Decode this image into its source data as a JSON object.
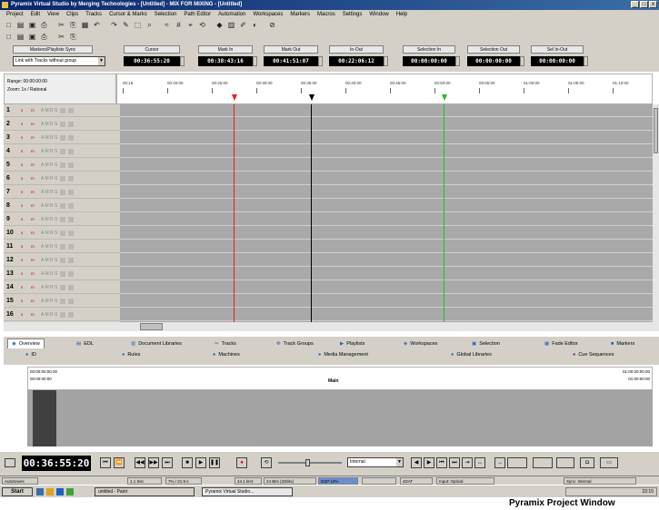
{
  "window": {
    "title": "Pyramix Virtual Studio by Merging Technologies - [Untitled] - MIX FOR MIXING - [Untitled]",
    "controls": [
      "_",
      "□",
      "x"
    ]
  },
  "menubar": [
    "Project",
    "Edit",
    "View",
    "Clips",
    "Tracks",
    "Cursor & Marks",
    "Selection",
    "Path Editor",
    "Automation",
    "Workspaces",
    "Markers",
    "Macros",
    "Settings",
    "Window",
    "Help"
  ],
  "toolbar1_icons": [
    "new-icon",
    "open-icon",
    "save-icon",
    "print-icon",
    "cut-icon",
    "copy-icon",
    "paste-icon",
    "undo-icon",
    "redo-icon",
    "tool-icon",
    "select-icon",
    "zoom-icon",
    "scrub-icon",
    "grid-icon",
    "snap-icon",
    "loop-icon",
    "marker-icon",
    "mix-icon",
    "edit-icon",
    "gain-icon",
    "mute-icon"
  ],
  "toolbar2_icons": [
    "view-icon",
    "track-icon",
    "layer-icon",
    "group-icon",
    "link-icon",
    "help-icon"
  ],
  "fields": {
    "markers": {
      "label": "Markers/Playlists Sync",
      "value": "Link with Tracks without group"
    },
    "cursor": {
      "label": "Cursor",
      "value": "00:36:55:20"
    },
    "mark_in": {
      "label": "Mark In",
      "value": "00:38:43:16"
    },
    "mark_out": {
      "label": "Mark Out",
      "value": "00:41:51:07"
    },
    "in_out": {
      "label": "In-Out",
      "value": "00:22:06:12"
    },
    "selection_in": {
      "label": "Selection In",
      "value": "00:00:00:00"
    },
    "selection_out": {
      "label": "Selection Out",
      "value": "00:00:00:00"
    },
    "sel_in_out": {
      "label": "Sel In-Out",
      "value": "00:00:00:00"
    }
  },
  "ruler": {
    "range_label": "Range: 00:00:00:00",
    "zoom_label": "Zoom: 1x / Rational",
    "ticks": [
      "00:18",
      "00:20:00",
      "00:25:00",
      "00:30:00",
      "00:35:00",
      "00:40:00",
      "00:45:00",
      "00:50:00",
      "00:55:00",
      "01:00:00",
      "01:05:00",
      "01:10:00"
    ]
  },
  "tracks": [
    {
      "n": "1",
      "s": "s",
      "m": "m"
    },
    {
      "n": "2",
      "s": "s",
      "m": "m"
    },
    {
      "n": "3",
      "s": "s",
      "m": "m"
    },
    {
      "n": "4",
      "s": "s",
      "m": "m"
    },
    {
      "n": "5",
      "s": "s",
      "m": "m"
    },
    {
      "n": "6",
      "s": "s",
      "m": "m"
    },
    {
      "n": "7",
      "s": "s",
      "m": "m"
    },
    {
      "n": "8",
      "s": "s",
      "m": "m"
    },
    {
      "n": "9",
      "s": "s",
      "m": "m"
    },
    {
      "n": "10",
      "s": "s",
      "m": "m"
    },
    {
      "n": "11",
      "s": "s",
      "m": "m"
    },
    {
      "n": "12",
      "s": "s",
      "m": "m"
    },
    {
      "n": "13",
      "s": "s",
      "m": "m"
    },
    {
      "n": "14",
      "s": "s",
      "m": "m"
    },
    {
      "n": "15",
      "s": "s",
      "m": "m"
    },
    {
      "n": "16",
      "s": "s",
      "m": "m"
    }
  ],
  "track_flags": "A M R S",
  "tabs": [
    "Overview",
    "EDL",
    "Document Libraries",
    "Tracks",
    "Track Groups",
    "Playlists",
    "Workspaces",
    "Selection",
    "Fade Editor",
    "Markers"
  ],
  "subbar": [
    "ID",
    "Rules",
    "Machines",
    "Media Management",
    "Global Libraries",
    "Cue Sequences"
  ],
  "overview": {
    "left_top": "00:00:00:00.00",
    "left_bot": "00:00:00:00",
    "center": "Main",
    "right_top": "01:00:00:00.00",
    "right_bot": "01:00:00:00"
  },
  "transport": {
    "timecode": "00:36:55:20",
    "sync_mode": "Internal",
    "buttons": [
      "rewind-to-start",
      "fast-rewind",
      "fast-forward",
      "stop",
      "play",
      "pause",
      "record",
      "loop"
    ]
  },
  "status": [
    "AutoSaves",
    "1.1 Sec",
    "7% / 21.9 s",
    "44.1 kHz",
    "24 Bits (32bits)",
    "DSP 10%",
    "",
    "4DAT",
    "Input: Optical",
    "Sync: Internal"
  ],
  "taskbar": {
    "start": "Start",
    "tasks": [
      "untitled - Paint",
      "Pyramix Virtual Studio..."
    ],
    "clock": "22:15"
  },
  "caption": "Pyramix Project Window",
  "colors": {
    "title_bar": "#0a246a",
    "track_area": "#a9a9a9",
    "red_marker": "#e02020",
    "black_marker": "#000000",
    "green_marker": "#20c020",
    "timecode_bg": "#000000"
  }
}
